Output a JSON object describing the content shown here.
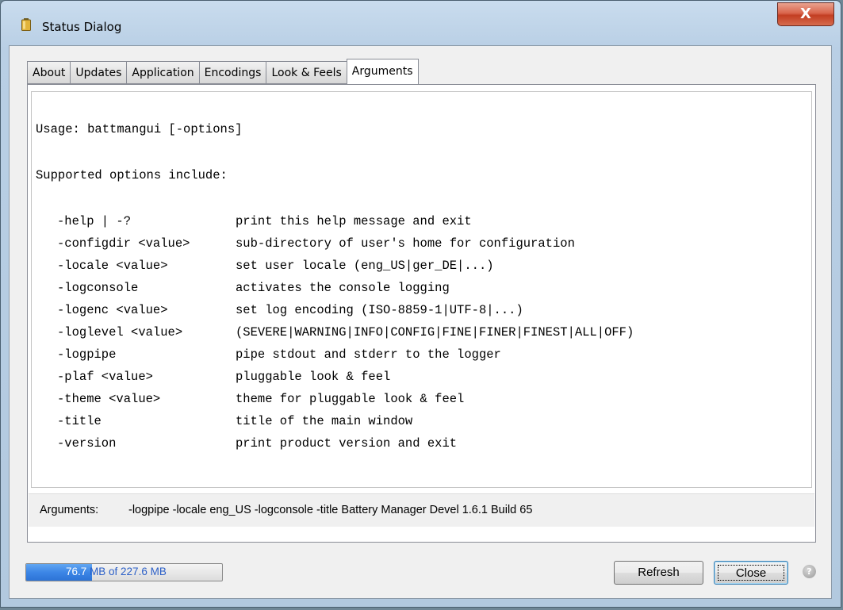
{
  "window": {
    "title": "Status Dialog",
    "close_glyph": "X"
  },
  "tabs": [
    {
      "label": "About"
    },
    {
      "label": "Updates"
    },
    {
      "label": "Application"
    },
    {
      "label": "Encodings"
    },
    {
      "label": "Look & Feels"
    },
    {
      "label": "Arguments",
      "active": true
    }
  ],
  "content": {
    "usage": "Usage: battmangui [-options]",
    "supported": "Supported options include:",
    "options": [
      {
        "name": "-help | -?",
        "desc": "print this help message and exit"
      },
      {
        "name": "-configdir <value>",
        "desc": "sub-directory of user's home for configuration"
      },
      {
        "name": "-locale <value>",
        "desc": "set user locale (eng_US|ger_DE|...)"
      },
      {
        "name": "-logconsole",
        "desc": "activates the console logging"
      },
      {
        "name": "-logenc <value>",
        "desc": "set log encoding (ISO-8859-1|UTF-8|...)"
      },
      {
        "name": "-loglevel <value>",
        "desc": "(SEVERE|WARNING|INFO|CONFIG|FINE|FINER|FINEST|ALL|OFF)"
      },
      {
        "name": "-logpipe",
        "desc": "pipe stdout and stderr to the logger"
      },
      {
        "name": "-plaf <value>",
        "desc": "pluggable look & feel"
      },
      {
        "name": "-theme <value>",
        "desc": "theme for pluggable look & feel"
      },
      {
        "name": "-title",
        "desc": "title of the main window"
      },
      {
        "name": "-version",
        "desc": "print product version and exit"
      }
    ]
  },
  "arguments": {
    "label": "Arguments:",
    "value": "-logpipe -locale eng_US -logconsole -title Battery Manager Devel 1.6.1 Build 65"
  },
  "memory": {
    "used": "76.7",
    "rest": " MB of 227.6 MB",
    "fraction": 0.337
  },
  "buttons": {
    "refresh": "Refresh",
    "close": "Close"
  },
  "colors": {
    "memory_fill": "#3c86e6",
    "close_button_red": "#c23e22"
  }
}
